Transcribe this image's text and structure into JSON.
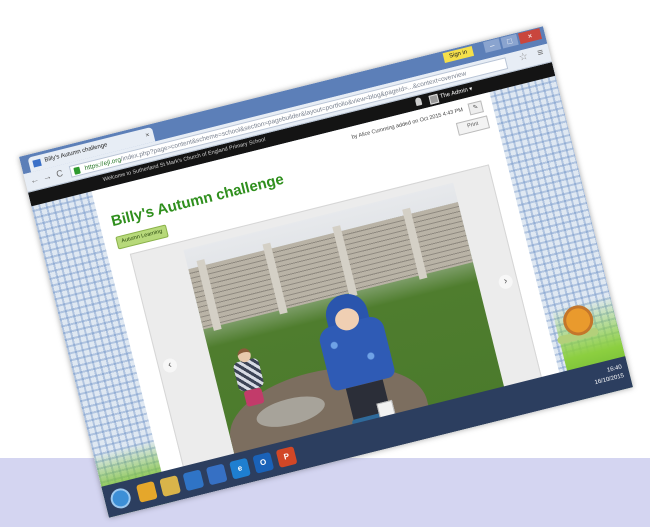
{
  "browser": {
    "tab_title": "Billy's Autumn challenge",
    "tab_close": "×",
    "sign_in": "Sign in",
    "min": "–",
    "max": "□",
    "close": "×",
    "nav_back": "←",
    "nav_forward": "→",
    "nav_reload": "C",
    "url_secure": "https://ejl.org",
    "url_rest": "/index.php?page=content&scheme=school&section=pagebuilder&layout=portfolio&view=blog&pageId=...&context=overview",
    "star": "☆",
    "menu": "≡"
  },
  "site": {
    "school_name": "Welcome to Sutherland St Mark's Church of England Primary School",
    "admin": "The Admin ▾"
  },
  "post": {
    "byline": "by Alice Cumming added on Oct 2015 4:43 PM",
    "edit": "✎",
    "print": "Print",
    "title": "Billy's Autumn challenge",
    "tag": "Autumn Learning",
    "prev": "‹",
    "next": "›"
  },
  "taskbar": {
    "ie": "e",
    "outlook": "O",
    "powerpoint": "P",
    "time": "16:40",
    "date": "16/10/2015"
  },
  "colors": {
    "title_green": "#2f8f1d",
    "chrome_blue": "#5c7fb8",
    "band": "#d4d5f1"
  }
}
